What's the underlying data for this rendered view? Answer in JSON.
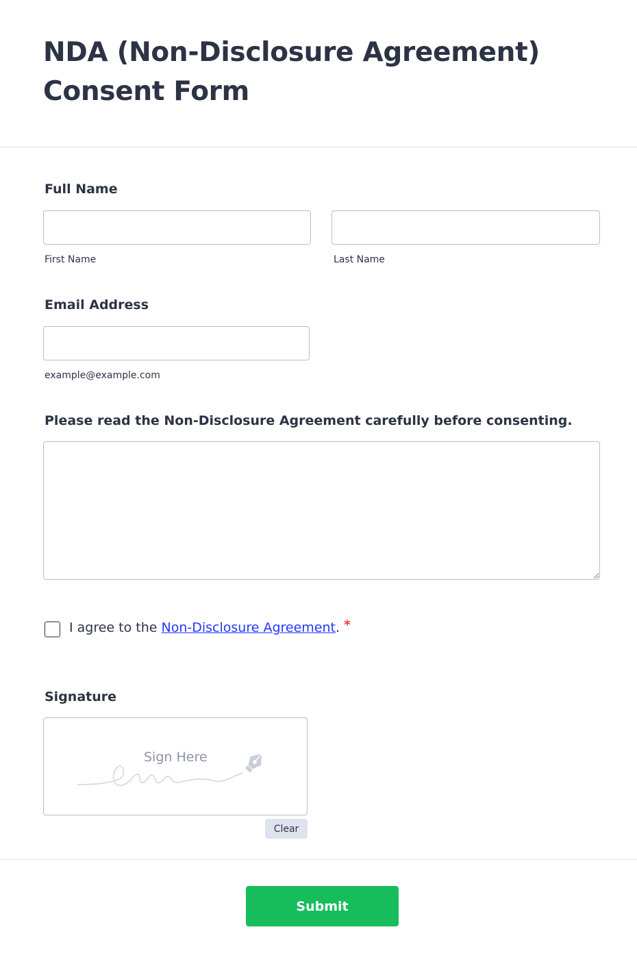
{
  "form": {
    "title": "NDA (Non-Disclosure Agreement) Consent Form"
  },
  "full_name": {
    "label": "Full Name",
    "first": {
      "value": "",
      "sublabel": "First Name"
    },
    "last": {
      "value": "",
      "sublabel": "Last Name"
    }
  },
  "email": {
    "label": "Email Address",
    "value": "",
    "sublabel": "example@example.com"
  },
  "agreement_text": {
    "label": "Please read the Non-Disclosure Agreement carefully before consenting.",
    "value": ""
  },
  "consent": {
    "checked": false,
    "text_prefix": "I agree to the ",
    "link_text": "Non-Disclosure Agreement",
    "text_suffix": ".",
    "required_mark": "*"
  },
  "signature": {
    "label": "Signature",
    "placeholder": "Sign Here",
    "clear_label": "Clear",
    "icon": "pen-nib-icon"
  },
  "submit": {
    "label": "Submit"
  },
  "colors": {
    "text": "#2c3345",
    "border": "#b8bdc9",
    "link": "#2436ff",
    "required": "#f23a3c",
    "submit_bg": "#18bd5b",
    "clear_bg": "#dfe3ef"
  }
}
